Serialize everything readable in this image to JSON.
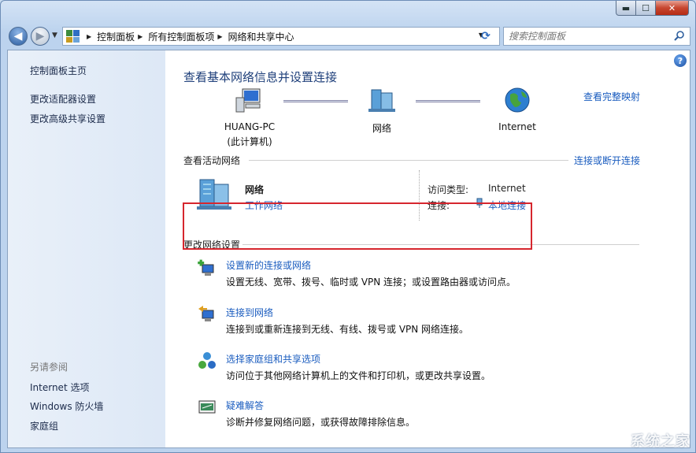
{
  "window": {
    "min_symbol": "▬",
    "max_symbol": "☐",
    "close_symbol": "✕"
  },
  "nav": {
    "back_symbol": "◀",
    "forward_symbol": "▶",
    "breadcrumb": [
      "控制面板",
      "所有控制面板项",
      "网络和共享中心"
    ],
    "search_placeholder": "搜索控制面板"
  },
  "sidebar": {
    "links": [
      "控制面板主页",
      "更改适配器设置",
      "更改高级共享设置"
    ],
    "see_also_heading": "另请参阅",
    "see_also": [
      "Internet 选项",
      "Windows 防火墙",
      "家庭组"
    ]
  },
  "main": {
    "title": "查看基本网络信息并设置连接",
    "view_full_map": "查看完整映射",
    "map": {
      "computer_name": "HUANG-PC",
      "computer_sub": "(此计算机)",
      "network": "网络",
      "internet": "Internet"
    },
    "active": {
      "heading": "查看活动网络",
      "connect_disconnect": "连接或断开连接",
      "network_name": "网络",
      "network_type": "工作网络",
      "access_type_label": "访问类型:",
      "access_type_value": "Internet",
      "connections_label": "连接:",
      "connections_value": "本地连接"
    },
    "change": {
      "heading": "更改网络设置",
      "tasks": [
        {
          "title": "设置新的连接或网络",
          "desc": "设置无线、宽带、拨号、临时或 VPN 连接；或设置路由器或访问点。"
        },
        {
          "title": "连接到网络",
          "desc": "连接到或重新连接到无线、有线、拨号或 VPN 网络连接。"
        },
        {
          "title": "选择家庭组和共享选项",
          "desc": "访问位于其他网络计算机上的文件和打印机，或更改共享设置。"
        },
        {
          "title": "疑难解答",
          "desc": "诊断并修复网络问题，或获得故障排除信息。"
        }
      ]
    },
    "help_symbol": "?"
  },
  "watermark": "系统之家",
  "colors": {
    "link": "#1a5cbf",
    "highlight": "#d6262e",
    "title": "#1e3f7a"
  }
}
